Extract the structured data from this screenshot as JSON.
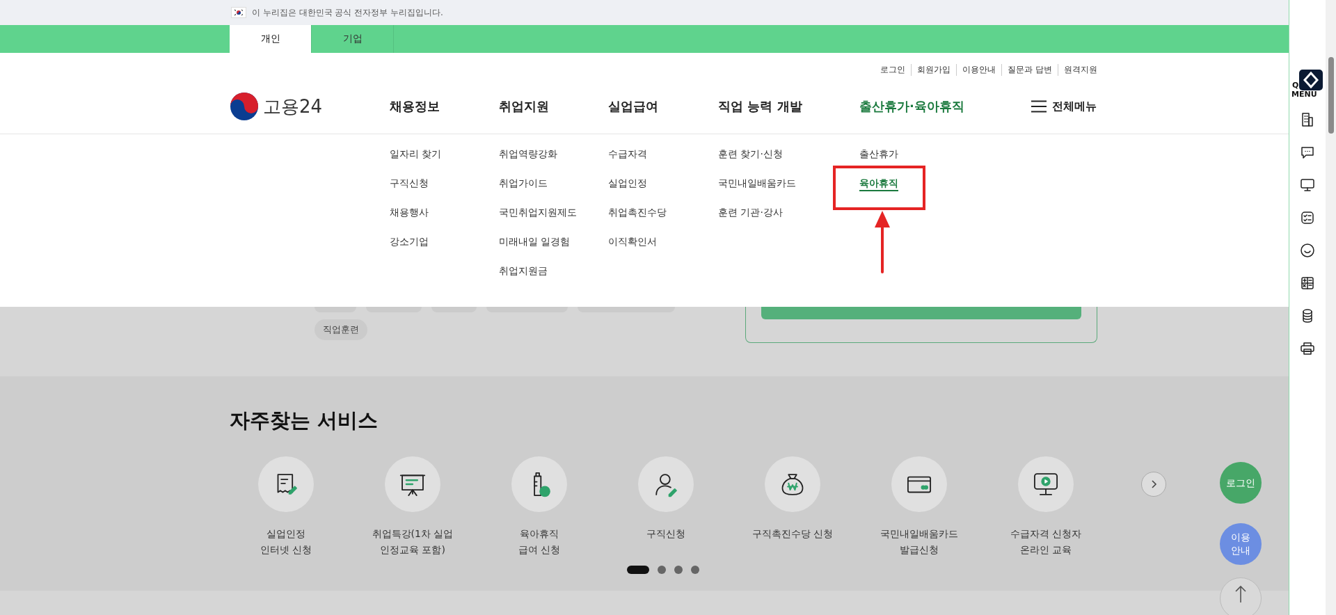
{
  "gov_banner": {
    "text": "이 누리집은 대한민국 공식 전자정부 누리집입니다."
  },
  "audience_tabs": [
    {
      "label": "개인",
      "selected": true
    },
    {
      "label": "기업",
      "selected": false
    }
  ],
  "utility_links": [
    "로그인",
    "회원가입",
    "이용안내",
    "질문과 답변",
    "원격지원"
  ],
  "logo": {
    "text": "고용24"
  },
  "nav": [
    {
      "label": "채용정보",
      "selected": false,
      "items": [
        {
          "label": "일자리 찾기",
          "selected": false,
          "highlighted": false
        },
        {
          "label": "구직신청",
          "selected": false,
          "highlighted": false
        },
        {
          "label": "채용행사",
          "selected": false,
          "highlighted": false
        },
        {
          "label": "강소기업",
          "selected": false,
          "highlighted": false
        }
      ]
    },
    {
      "label": "취업지원",
      "selected": false,
      "items": [
        {
          "label": "취업역량강화",
          "selected": false,
          "highlighted": false
        },
        {
          "label": "취업가이드",
          "selected": false,
          "highlighted": false
        },
        {
          "label": "국민취업지원제도",
          "selected": false,
          "highlighted": false
        },
        {
          "label": "미래내일 일경험",
          "selected": false,
          "highlighted": false
        },
        {
          "label": "취업지원금",
          "selected": false,
          "highlighted": false
        }
      ]
    },
    {
      "label": "실업급여",
      "selected": false,
      "items": [
        {
          "label": "수급자격",
          "selected": false,
          "highlighted": false
        },
        {
          "label": "실업인정",
          "selected": false,
          "highlighted": false
        },
        {
          "label": "취업촉진수당",
          "selected": false,
          "highlighted": false
        },
        {
          "label": "이직확인서",
          "selected": false,
          "highlighted": false
        }
      ]
    },
    {
      "label": "직업 능력 개발",
      "selected": false,
      "items": [
        {
          "label": "훈련 찾기·신청",
          "selected": false,
          "highlighted": false
        },
        {
          "label": "국민내일배움카드",
          "selected": false,
          "highlighted": false
        },
        {
          "label": "훈련 기관·강사",
          "selected": false,
          "highlighted": false
        }
      ]
    },
    {
      "label": "출산휴가·육아휴직",
      "selected": true,
      "items": [
        {
          "label": "출산휴가",
          "selected": false,
          "highlighted": false
        },
        {
          "label": "육아휴직",
          "selected": true,
          "highlighted": true
        }
      ]
    }
  ],
  "all_menu": {
    "label": "전체메뉴"
  },
  "tags": [
    {
      "label": "직업훈련"
    }
  ],
  "services": {
    "title": "자주찾는 서비스",
    "items": [
      {
        "label": "실업인정\n인터넷 신청"
      },
      {
        "label": "취업특강(1차 실업\n인정교육 포함)"
      },
      {
        "label": "육아휴직\n급여 신청"
      },
      {
        "label": "구직신청"
      },
      {
        "label": "구직촉진수당 신청"
      },
      {
        "label": "국민내일배움카드\n발급신청"
      },
      {
        "label": "수급자격 신청자\n온라인 교육"
      }
    ],
    "pages": [
      {
        "selected": true
      },
      {
        "selected": false
      },
      {
        "selected": false
      },
      {
        "selected": false
      }
    ]
  },
  "side_buttons": [
    {
      "label": "로그인",
      "kind": "login"
    },
    {
      "label": "이용\n안내",
      "kind": "guide"
    }
  ],
  "quick_menu": {
    "label_start": "Q",
    "label_end": "MENU"
  }
}
